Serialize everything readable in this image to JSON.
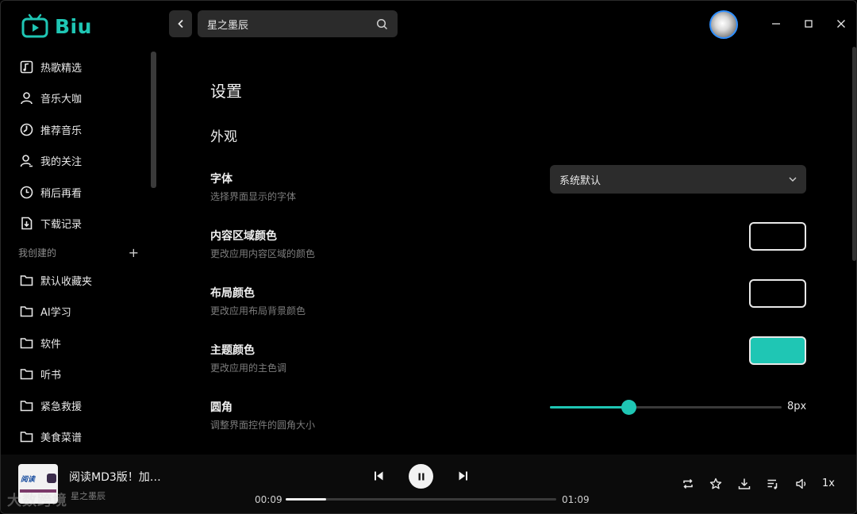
{
  "app": {
    "name": "Biu"
  },
  "search": {
    "value": "星之墨辰"
  },
  "sidebar": {
    "items": [
      {
        "label": "热歌精选",
        "icon": "music-note-icon"
      },
      {
        "label": "音乐大咖",
        "icon": "user-icon"
      },
      {
        "label": "推荐音乐",
        "icon": "disc-icon"
      },
      {
        "label": "我的关注",
        "icon": "user-follow-icon"
      },
      {
        "label": "稍后再看",
        "icon": "clock-icon"
      },
      {
        "label": "下载记录",
        "icon": "download-file-icon"
      }
    ],
    "section_label": "我创建的",
    "section_add": "+",
    "folders": [
      {
        "label": "默认收藏夹"
      },
      {
        "label": "AI学习"
      },
      {
        "label": "软件"
      },
      {
        "label": "听书"
      },
      {
        "label": "紧急救援"
      },
      {
        "label": "美食菜谱"
      }
    ]
  },
  "settings": {
    "title": "设置",
    "section": "外观",
    "font": {
      "label": "字体",
      "desc": "选择界面显示的字体",
      "value": "系统默认"
    },
    "content_color": {
      "label": "内容区域颜色",
      "desc": "更改应用内容区域的颜色",
      "color": "#000000"
    },
    "layout_color": {
      "label": "布局颜色",
      "desc": "更改应用布局背景颜色",
      "color": "#000000"
    },
    "theme_color": {
      "label": "主题颜色",
      "desc": "更改应用的主色调",
      "color": "#1fc6b4"
    },
    "radius": {
      "label": "圆角",
      "desc": "调整界面控件的圆角大小",
      "value": "8px",
      "fraction": 0.34
    }
  },
  "player": {
    "title": "阅读MD3版！加…",
    "artist": "星之墨辰",
    "current_time": "00:09",
    "total_time": "01:09",
    "progress": 0.15,
    "speed": "1x",
    "watermark": "大数跨境",
    "cover_text": "阅读"
  },
  "colors": {
    "accent": "#1fc6b4",
    "background": "#000000",
    "panel": "#2b2b2b"
  }
}
